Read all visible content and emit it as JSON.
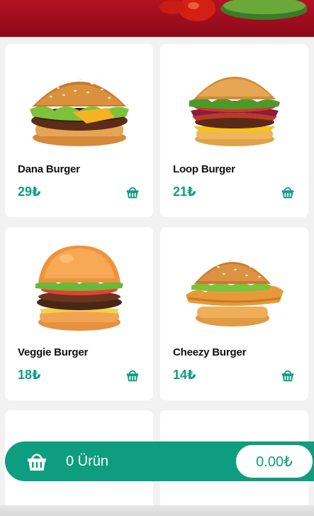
{
  "theme": {
    "accent": "#0e9e7f",
    "header": "#a30f20"
  },
  "products": [
    {
      "name": "Dana Burger",
      "price": "29₺",
      "icon": "basket-icon"
    },
    {
      "name": "Loop Burger",
      "price": "21₺",
      "icon": "basket-icon"
    },
    {
      "name": "Veggie Burger",
      "price": "18₺",
      "icon": "basket-icon"
    },
    {
      "name": "Cheezy Burger",
      "price": "14₺",
      "icon": "basket-icon"
    }
  ],
  "cart": {
    "count_label": "0 Ürün",
    "total": "0.00₺",
    "icon": "basket-icon"
  }
}
